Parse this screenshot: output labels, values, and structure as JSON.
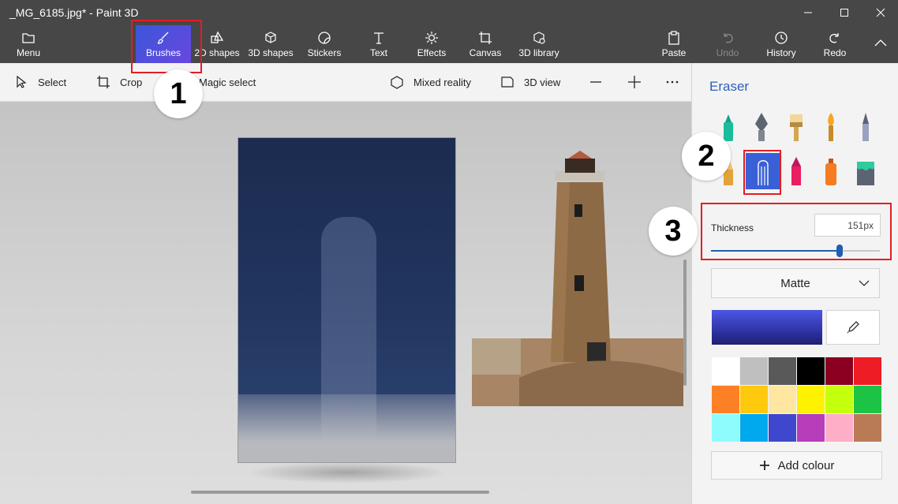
{
  "window": {
    "title": "_MG_6185.jpg* - Paint 3D"
  },
  "ribbon": {
    "menu": "Menu",
    "brushes": "Brushes",
    "shapes2d": "2D shapes",
    "shapes3d": "3D shapes",
    "stickers": "Stickers",
    "text": "Text",
    "effects": "Effects",
    "canvas": "Canvas",
    "library3d": "3D library",
    "paste": "Paste",
    "undo": "Undo",
    "history": "History",
    "redo": "Redo"
  },
  "subtoolbar": {
    "select": "Select",
    "crop": "Crop",
    "magic_select": "Magic select",
    "mixed_reality": "Mixed reality",
    "view3d": "3D view"
  },
  "panel": {
    "title": "Eraser",
    "thickness_label": "Thickness",
    "thickness_value": "151px",
    "thickness_fraction": 0.76,
    "finish": "Matte",
    "add_colour": "Add colour",
    "current_color": "#3c44cc",
    "palette": [
      "#ffffff",
      "#bfbfbf",
      "#595959",
      "#000000",
      "#8b0020",
      "#ee1c24",
      "#fe8026",
      "#ffc90d",
      "#ffe7a1",
      "#fff200",
      "#c4ff0e",
      "#1cc445",
      "#8efcfd",
      "#00a9ed",
      "#3f48cc",
      "#b83dba",
      "#ffaec8",
      "#b97a56"
    ]
  },
  "callouts": {
    "one": "1",
    "two": "2",
    "three": "3"
  }
}
